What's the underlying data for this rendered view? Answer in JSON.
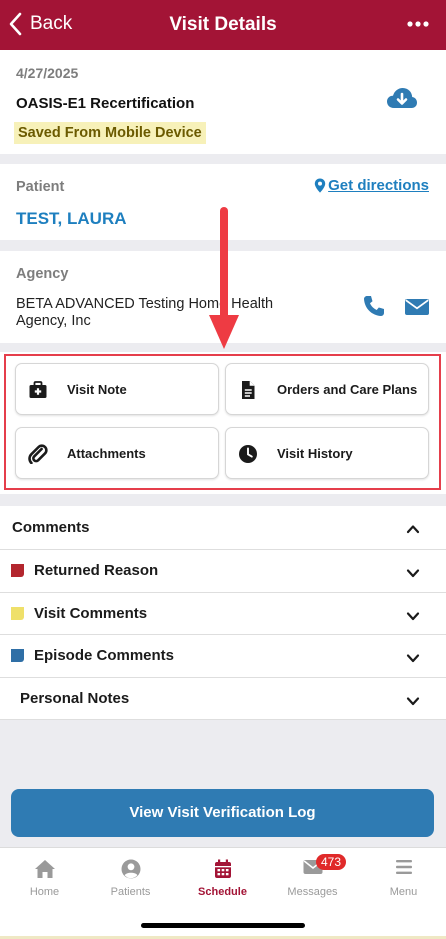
{
  "header": {
    "back_label": "Back",
    "title": "Visit Details"
  },
  "visit": {
    "date": "4/27/2025",
    "type": "OASIS-E1 Recertification",
    "status": "Saved From Mobile Device"
  },
  "patient": {
    "label": "Patient",
    "name": "TEST, LAURA",
    "directions_label": "Get directions"
  },
  "agency": {
    "label": "Agency",
    "name": "BETA ADVANCED Testing Home Health Agency, Inc"
  },
  "actions": [
    "Visit Note",
    "Orders and Care Plans",
    "Attachments",
    "Visit History"
  ],
  "comments": {
    "header": "Comments",
    "items": [
      {
        "label": "Returned Reason",
        "color": "#b3262e"
      },
      {
        "label": "Visit Comments",
        "color": "#efe06a"
      },
      {
        "label": "Episode Comments",
        "color": "#2f6fa6"
      },
      {
        "label": "Personal Notes",
        "color": ""
      }
    ]
  },
  "verify_button": "View Visit Verification Log",
  "tabs": [
    {
      "label": "Home",
      "icon": "home-icon"
    },
    {
      "label": "Patients",
      "icon": "user-icon"
    },
    {
      "label": "Schedule",
      "icon": "calendar-icon"
    },
    {
      "label": "Messages",
      "icon": "mail-icon"
    },
    {
      "label": "Menu",
      "icon": "menu-icon"
    }
  ],
  "messages_badge": "473",
  "colors": {
    "brand": "#a31436",
    "link": "#1e7fbf",
    "button": "#2f7bb3",
    "highlight": "#e53e4b"
  }
}
